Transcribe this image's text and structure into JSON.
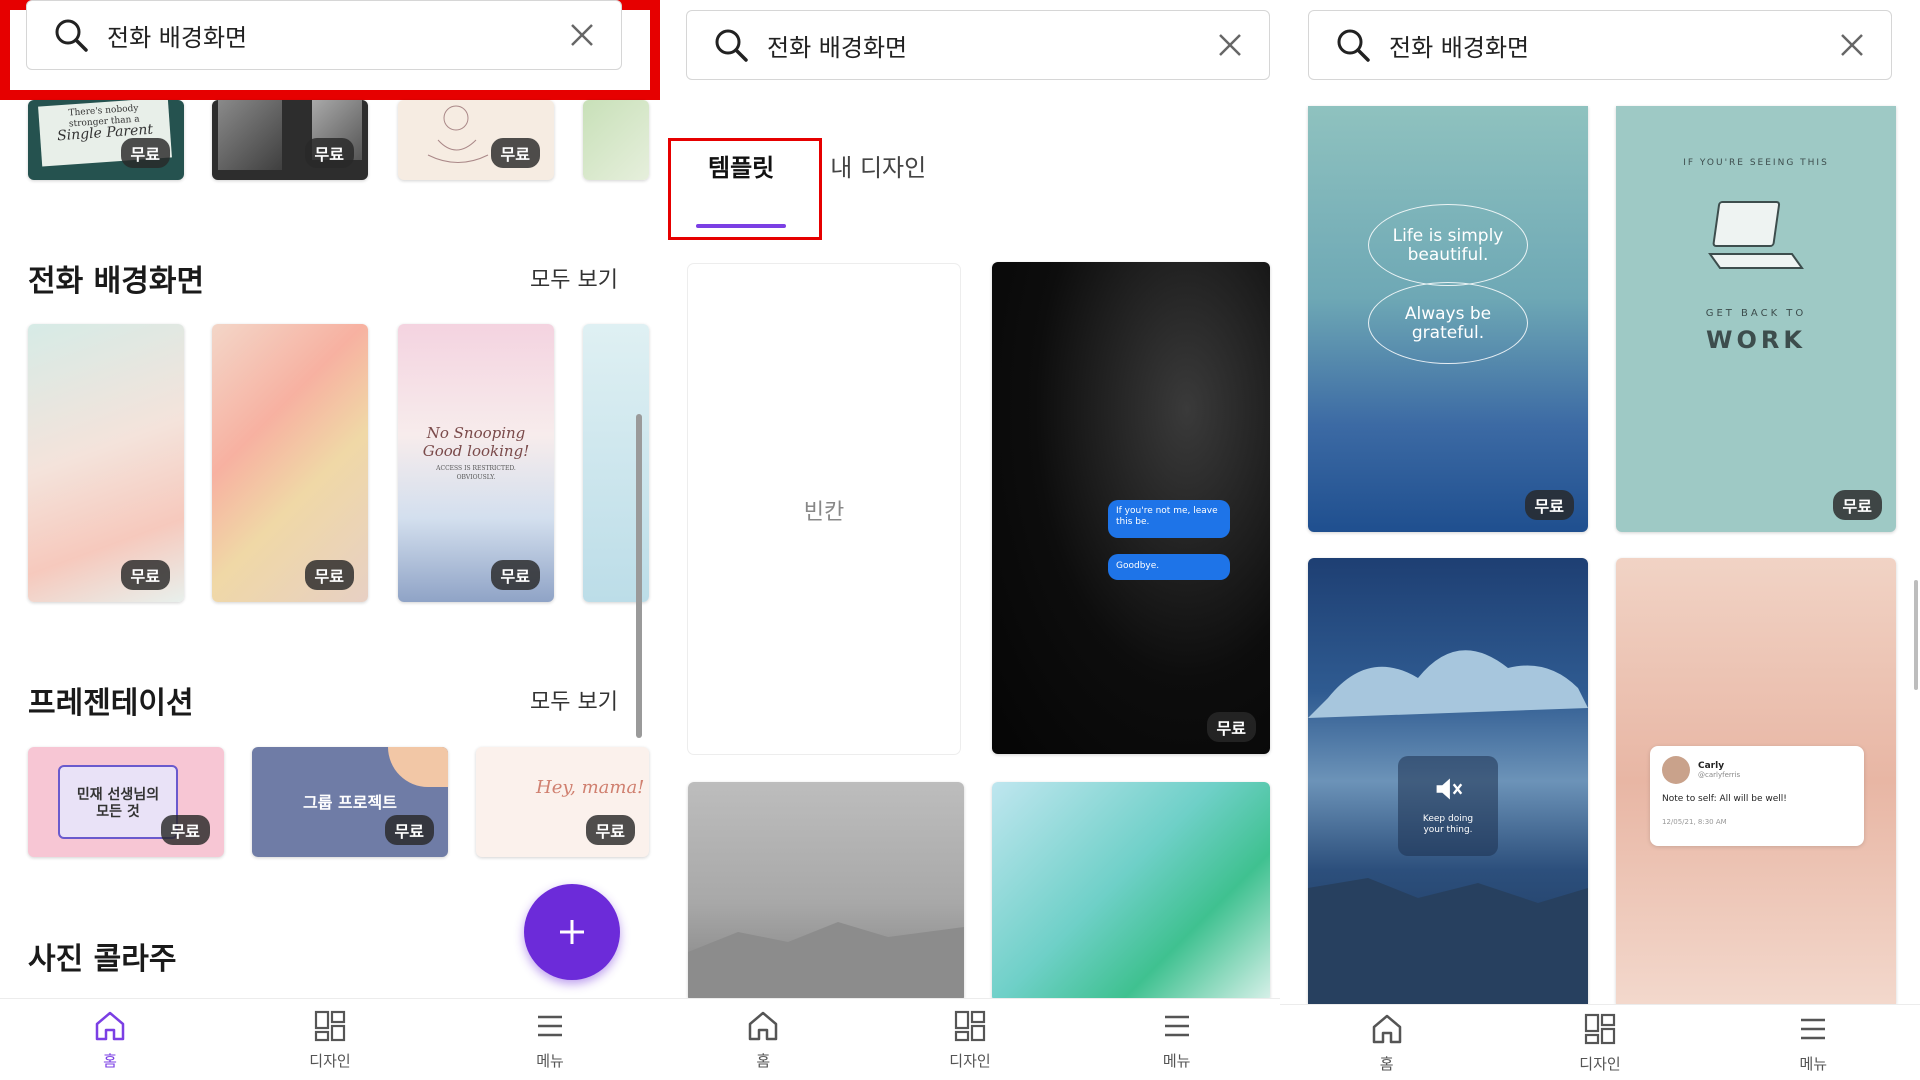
{
  "search": {
    "query": "전화 배경화면"
  },
  "badge_free": "무료",
  "screen1": {
    "sections": [
      {
        "title": "전화 배경화면",
        "see_all": "모두 보기"
      },
      {
        "title": "프레젠테이션",
        "see_all": "모두 보기"
      },
      {
        "title": "사진 콜라주"
      }
    ],
    "top_cards": [
      {
        "text_lines": [
          "There's nobody",
          "stronger than a",
          "Single Parent"
        ]
      },
      {
        "text_lines": []
      },
      {
        "text_lines": []
      }
    ],
    "phone_card_text": [
      "No Snooping",
      "Good looking!",
      "ACCESS IS RESTRICTED.",
      "OBVIOUSLY."
    ],
    "presentation_cards": [
      {
        "text_lines": [
          "민재 선생님의",
          "모든 것"
        ]
      },
      {
        "text_lines": [
          "그룹 프로젝트"
        ]
      },
      {
        "text_lines": [
          "Hey, mama!"
        ]
      }
    ]
  },
  "screen2": {
    "tabs": [
      "템플릿",
      "내 디자인"
    ],
    "blank_label": "빈칸",
    "chat_bubbles": [
      "If you're not me, leave this be.",
      "Goodbye."
    ]
  },
  "screen3": {
    "card_a": [
      "Life is simply beautiful.",
      "Always be grateful."
    ],
    "card_b": {
      "top": "IF YOU'RE SEEING THIS",
      "mid": "GET BACK TO",
      "big": "WORK"
    },
    "card_c": {
      "caption": "Keep doing your thing."
    },
    "card_d": {
      "name": "Carly",
      "handle": "@carlyferris",
      "message": "Note to self: All will be well!",
      "time": "12/05/21, 8:30 AM"
    }
  },
  "nav": {
    "home": "홈",
    "design": "디자인",
    "menu": "메뉴"
  },
  "colors": {
    "accent": "#7b3fe4",
    "fab": "#6c2bd9",
    "highlight": "#e60000"
  }
}
